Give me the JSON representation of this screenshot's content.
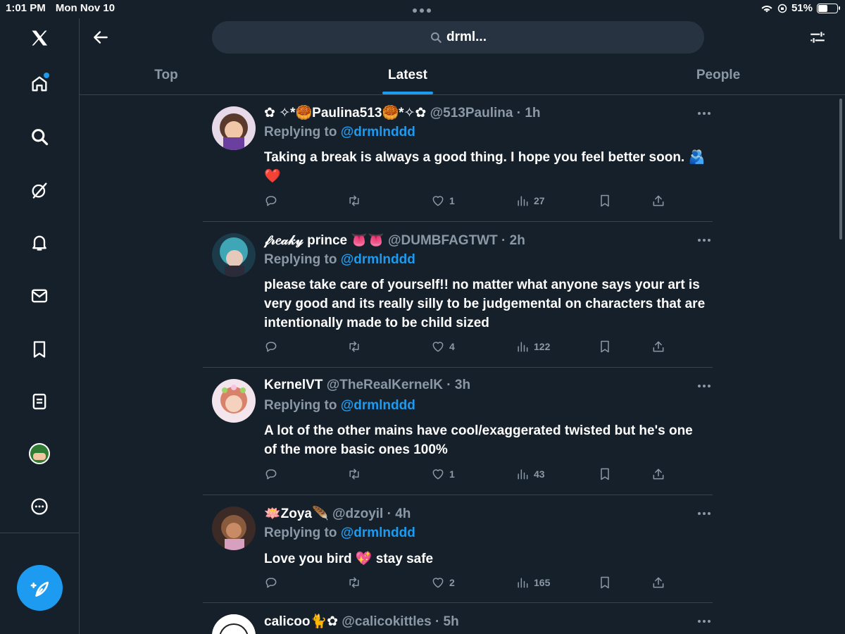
{
  "status": {
    "time": "1:01 PM",
    "date": "Mon Nov 10",
    "battery": "51%",
    "battery_level": 0.51
  },
  "search": {
    "query": "drml..."
  },
  "tabs": [
    {
      "label": "Top"
    },
    {
      "label": "Latest"
    },
    {
      "label": "People"
    }
  ],
  "active_tab": "Latest",
  "sidebar": {
    "items": [
      "x-logo-icon",
      "home-icon",
      "search-icon",
      "grok-icon",
      "notifications-icon",
      "messages-icon",
      "bookmarks-icon",
      "lists-icon",
      "profile-avatar",
      "more-icon"
    ],
    "notification_dot": true
  },
  "tweets": [
    {
      "name": "✿ ✧*🥮Paulina513🥮*✧✿",
      "handle": "@513Paulina",
      "time": "· 1h",
      "reply_prefix": "Replying to",
      "reply_to": "@drmlnddd",
      "text": "Taking a break is always a good thing. I hope you feel better soon. 🫂❤️",
      "likes": "1",
      "views": "27",
      "avatar_color": "#c98f7a"
    },
    {
      "name": "𝒻𝓇𝑒𝒶𝓀𝓎 prince 👅👅",
      "handle": "@DUMBFAGTWT",
      "time": "· 2h",
      "reply_prefix": "Replying to",
      "reply_to": "@drmlnddd",
      "text": "please take care of yourself!! no matter what anyone says your art is very good and its really silly to be judgemental on characters that are intentionally made to be child sized",
      "likes": "4",
      "views": "122",
      "avatar_color": "#3fa6b5"
    },
    {
      "name": "KernelVT",
      "handle": "@TheRealKernelK",
      "time": "· 3h",
      "reply_prefix": "Replying to",
      "reply_to": "@drmlnddd",
      "text": "A lot of the other mains have cool/exaggerated twisted but he's one of the more basic ones 100%",
      "likes": "1",
      "views": "43",
      "avatar_color": "#e8a98f"
    },
    {
      "name": "🪷Zoya🪶",
      "handle": "@dzoyil",
      "time": "· 4h",
      "reply_prefix": "Replying to",
      "reply_to": "@drmlnddd",
      "text": "Love you bird 💖 stay safe",
      "likes": "2",
      "views": "165",
      "avatar_color": "#8a5a3c"
    },
    {
      "name": "calicoo🐈✿",
      "handle": "@calicokittles",
      "time": "· 5h",
      "avatar_color": "#ffffff"
    }
  ]
}
